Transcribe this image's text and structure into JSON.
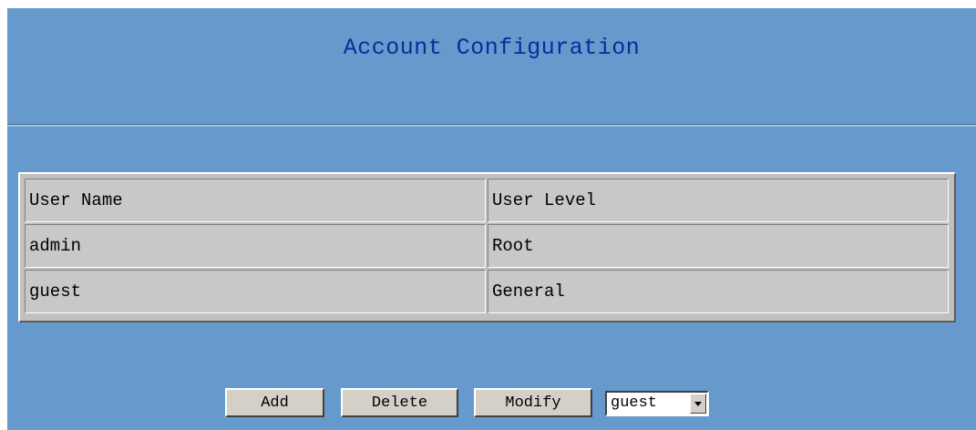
{
  "page": {
    "title": "Account Configuration"
  },
  "accounts_table": {
    "headers": [
      "User Name",
      "User Level"
    ],
    "rows": [
      [
        "admin",
        "Root"
      ],
      [
        "guest",
        "General"
      ]
    ]
  },
  "actions": {
    "add_label": "Add",
    "delete_label": "Delete",
    "modify_label": "Modify"
  },
  "user_select": {
    "selected": "guest"
  },
  "colors": {
    "panel_background": "#6699cc",
    "title_text": "#0a2d9a",
    "cell_background": "#c8c8c8"
  }
}
